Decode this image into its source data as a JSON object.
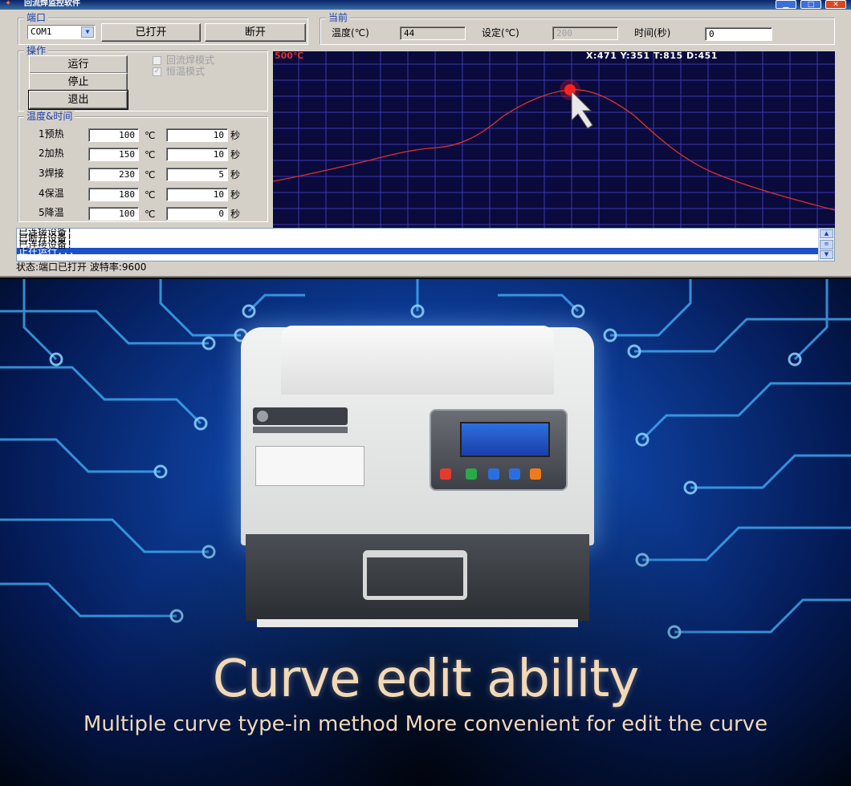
{
  "window": {
    "title": "回流焊监控软件"
  },
  "port": {
    "group_label": "端口",
    "com_value": "COM1",
    "open_button": "已打开",
    "close_button": "断开"
  },
  "current": {
    "group_label": "当前",
    "temp_label": "温度(℃)",
    "temp_value": "44",
    "set_label": "设定(℃)",
    "set_value": "200",
    "time_label": "时间(秒)",
    "time_value": "0"
  },
  "operation": {
    "group_label": "操作",
    "run_button": "运行",
    "stop_button": "停止",
    "exit_button": "退出",
    "reflow_mode": "回流焊模式",
    "constant_mode": "恒温模式"
  },
  "profile": {
    "group_label": "温度&时间",
    "temp_unit": "℃",
    "time_unit": "秒",
    "rows": [
      {
        "label": "1预热",
        "temp": "100",
        "time": "10"
      },
      {
        "label": "2加热",
        "temp": "150",
        "time": "10"
      },
      {
        "label": "3焊接",
        "temp": "230",
        "time": "5"
      },
      {
        "label": "4保温",
        "temp": "180",
        "time": "10"
      },
      {
        "label": "5降温",
        "temp": "100",
        "time": "0"
      }
    ]
  },
  "chart": {
    "max_label": "500℃",
    "coord_readout": "X:471 Y:351 T:815 D:451",
    "background": "#0a0a3c",
    "grid_color": "#3a3ab0",
    "curve_color": "#e03030",
    "marker_color": "#ff2020"
  },
  "log": {
    "lines": [
      "已连接设备!",
      "已断开设备!",
      "已连接设备!",
      "正在运行..."
    ]
  },
  "status": {
    "text": "状态:端口已打开 波特率:9600"
  },
  "poster": {
    "headline": "Curve edit ability",
    "subline": "Multiple curve type-in method  More convenient for edit the curve",
    "text_color": "#f2d9b8"
  }
}
